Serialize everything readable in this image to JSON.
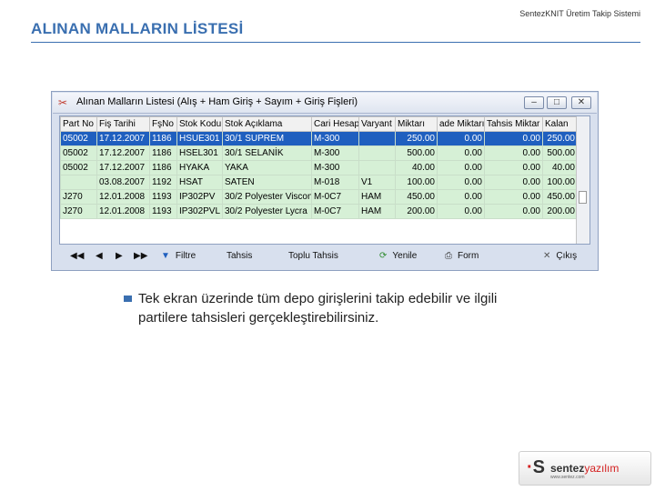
{
  "slide": {
    "title": "ALINAN MALLARIN LİSTESİ",
    "app_title": "SentezKNIT Üretim Takip Sistemi",
    "description": "Tek ekran üzerinde tüm depo girişlerini takip edebilir ve ilgili partilere tahsisleri gerçekleştirebilirsiniz."
  },
  "window": {
    "title": "Alınan Malların Listesi (Alış + Ham Giriş + Sayım + Giriş Fişleri)",
    "buttons": {
      "minimize": "–",
      "maximize": "□",
      "close": "✕"
    },
    "columns": [
      "Part No",
      "Fiş Tarihi",
      "FşNo",
      "Stok Kodu",
      "Stok Açıklama",
      "Cari Hesap",
      "Varyant",
      "Miktarı",
      "ade Miktarı",
      "Tahsis Miktar",
      "Kalan"
    ],
    "rows": [
      [
        "05002",
        "17.12.2007",
        "1186",
        "HSUE301",
        "30/1 SUPREM",
        "M-300",
        "",
        "250.00",
        "0.00",
        "0.00",
        "250.00"
      ],
      [
        "05002",
        "17.12.2007",
        "1186",
        "HSEL301",
        "30/1 SELANİK",
        "M-300",
        "",
        "500.00",
        "0.00",
        "0.00",
        "500.00"
      ],
      [
        "05002",
        "17.12.2007",
        "1186",
        "HYAKA",
        "YAKA",
        "M-300",
        "",
        "40.00",
        "0.00",
        "0.00",
        "40.00"
      ],
      [
        "",
        "03.08.2007",
        "1192",
        "HSAT",
        "SATEN",
        "M-018",
        "V1",
        "100.00",
        "0.00",
        "0.00",
        "100.00"
      ],
      [
        "J270",
        "12.01.2008",
        "1193",
        "IP302PV",
        "30/2 Polyester Viscon",
        "M-0C7",
        "HAM",
        "450.00",
        "0.00",
        "0.00",
        "450.00"
      ],
      [
        "J270",
        "12.01.2008",
        "1193",
        "IP302PVL",
        "30/2 Polyester Lycra",
        "M-0C7",
        "HAM",
        "200.00",
        "0.00",
        "0.00",
        "200.00"
      ]
    ],
    "selected_row": 0,
    "toolbar": {
      "first": "◀◀",
      "prev": "◀",
      "next": "▶",
      "last": "▶▶",
      "filter": "Filtre",
      "tahsis": "Tahsis",
      "toplu_tahsis": "Toplu Tahsis",
      "yenile": "Yenile",
      "form": "Form",
      "cikis": "Çıkış"
    }
  },
  "logo": {
    "mark": "S",
    "brand_a": "sentez",
    "brand_b": "yazılım",
    "site": "www.sentez.com"
  },
  "colors": {
    "title_blue": "#3a6fb0",
    "row_green": "#d6f0d6",
    "selected_blue": "#1f5fbf",
    "logo_red": "#d42020"
  }
}
